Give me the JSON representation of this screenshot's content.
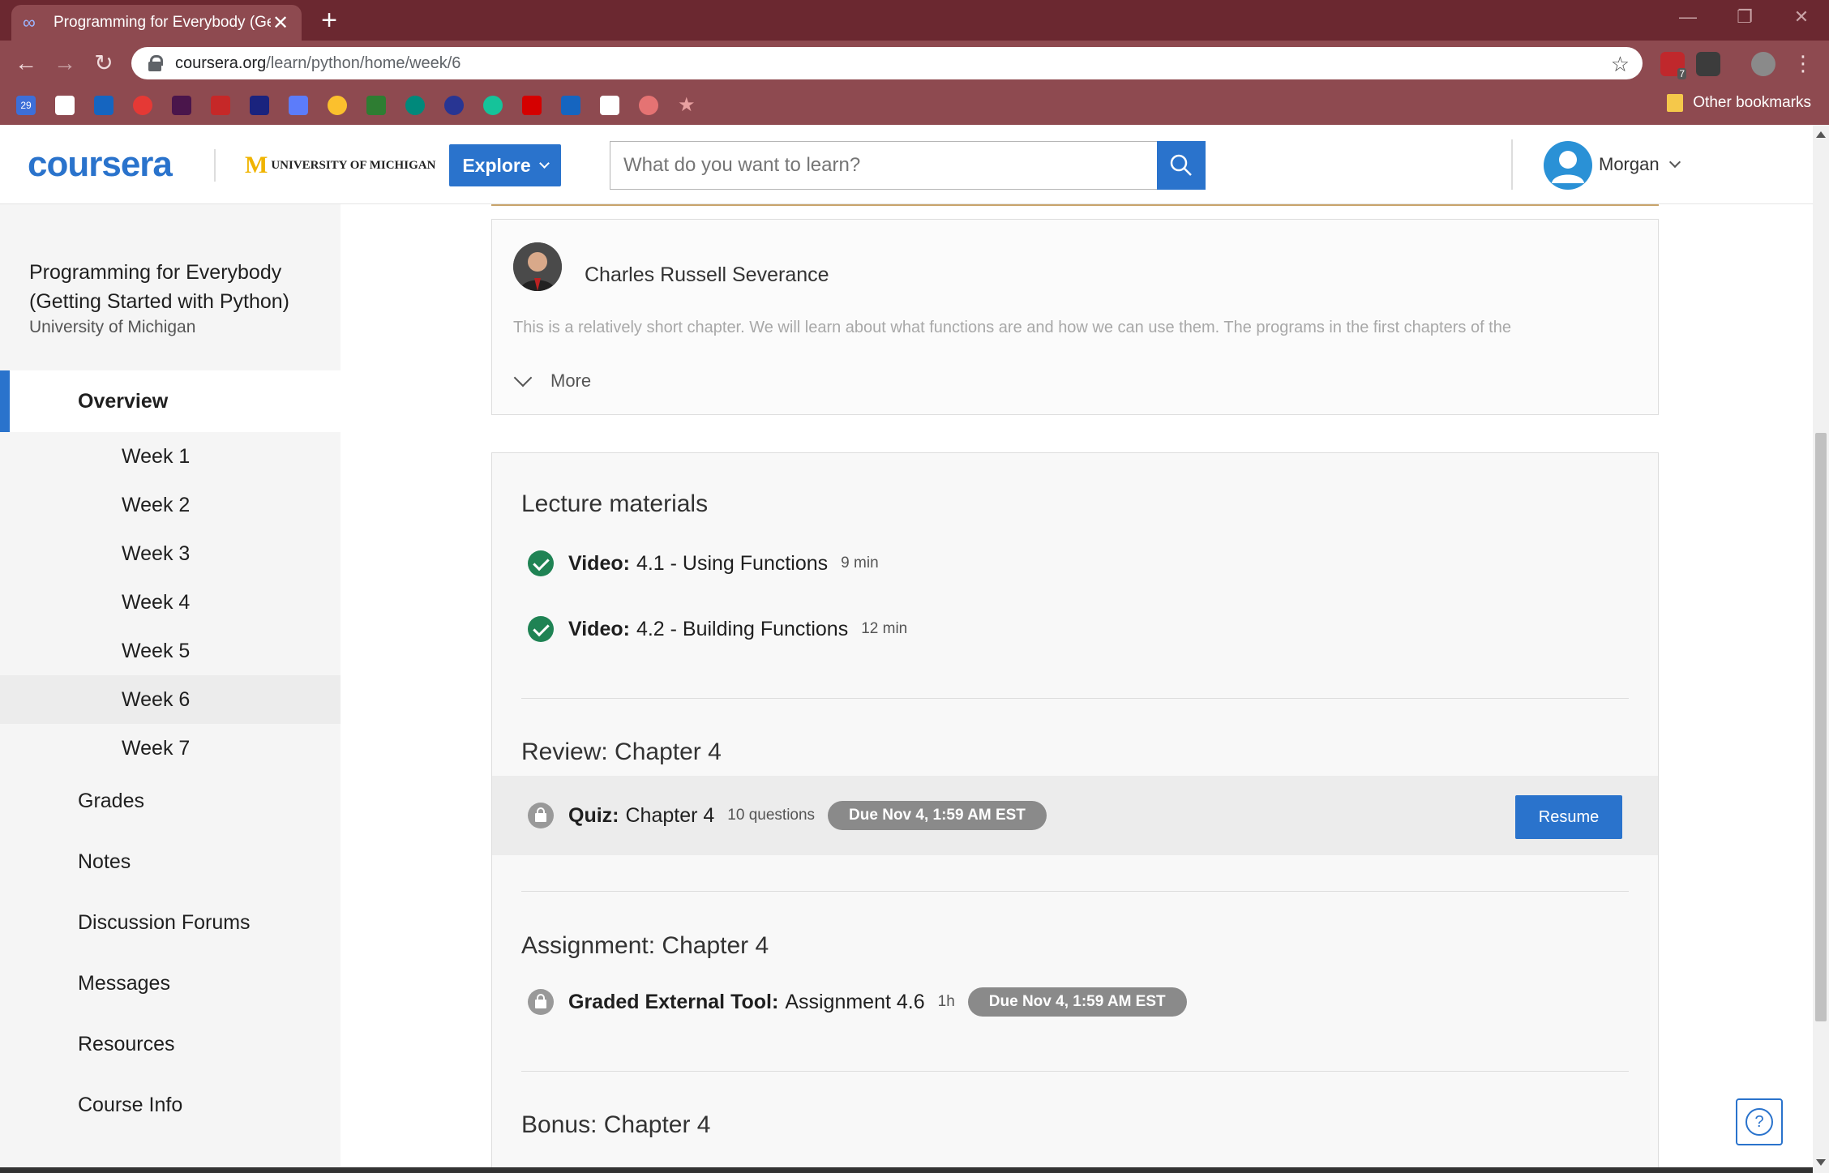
{
  "browser": {
    "tab_title": "Programming for Everybody (Get",
    "url_host": "coursera.org",
    "url_path": "/learn/python/home/week/6",
    "other_bookmarks": "Other bookmarks",
    "calendar_day": "29",
    "ext_badge": "7"
  },
  "header": {
    "logo": "coursera",
    "partner": "UNIVERSITY OF MICHIGAN",
    "partner_mark": "M",
    "explore_label": "Explore",
    "search_placeholder": "What do you want to learn?",
    "username": "Morgan"
  },
  "sidebar": {
    "course_title": "Programming for Everybody (Getting Started with Python)",
    "course_org": "University of Michigan",
    "overview": "Overview",
    "weeks": [
      "Week 1",
      "Week 2",
      "Week 3",
      "Week 4",
      "Week 5",
      "Week 6",
      "Week 7"
    ],
    "active_week": "Week 6",
    "items": [
      "Grades",
      "Notes",
      "Discussion Forums",
      "Messages",
      "Resources",
      "Course Info"
    ]
  },
  "instructor": {
    "name": "Charles Russell Severance",
    "description": "This is a relatively short chapter. We will learn about what functions are and how we can use them. The programs in the first chapters of the",
    "more_label": "More"
  },
  "lecture": {
    "title": "Lecture materials",
    "items": [
      {
        "kind": "Video:",
        "name": "4.1 - Using Functions",
        "meta": "9 min"
      },
      {
        "kind": "Video:",
        "name": "4.2 - Building Functions",
        "meta": "12 min"
      }
    ]
  },
  "review": {
    "title": "Review: Chapter 4",
    "quiz_kind": "Quiz:",
    "quiz_name": "Chapter 4",
    "quiz_meta": "10 questions",
    "quiz_due": "Due Nov 4, 1:59 AM EST",
    "resume_label": "Resume"
  },
  "assignment": {
    "title": "Assignment: Chapter 4",
    "kind": "Graded External Tool:",
    "name": "Assignment 4.6",
    "meta": "1h",
    "due": "Due Nov 4, 1:59 AM EST"
  },
  "bonus": {
    "title": "Bonus: Chapter 4"
  },
  "help_icon": "?",
  "colors": {
    "brand_blue": "#2a73cc",
    "complete_green": "#1f8354",
    "browser_frame": "#8e4a50"
  }
}
